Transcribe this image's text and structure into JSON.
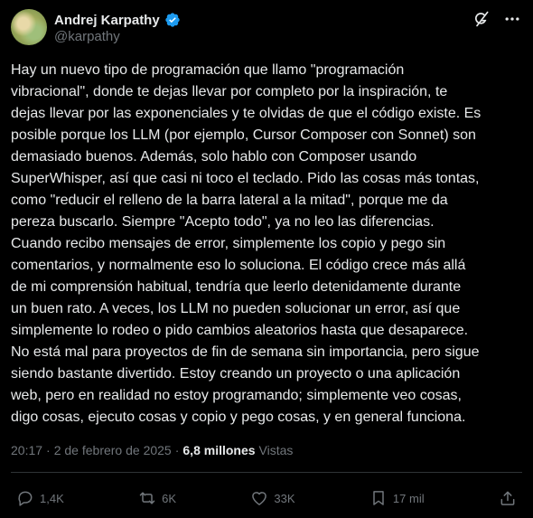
{
  "author": {
    "name": "Andrej Karpathy",
    "handle": "@karpathy",
    "verified_icon": "verified-badge-icon",
    "accent": "#1d9bf0"
  },
  "top_icons": [
    "grok-icon",
    "more-icon"
  ],
  "post": {
    "text": "Hay un nuevo tipo de programación que llamo \"programación\nvibracional\", donde te dejas llevar por completo por la inspiración, te\ndejas llevar por las exponenciales y te olvidas de que el código existe. Es\nposible porque los LLM (por ejemplo, Cursor Composer con Sonnet) son\ndemasiado buenos. Además, solo hablo con Composer usando\nSuperWhisper, así que casi ni toco el teclado. Pido las cosas más tontas,\ncomo \"reducir el relleno de la barra lateral a la mitad\", porque me da\npereza buscarlo. Siempre \"Acepto todo\", ya no leo las diferencias.\nCuando recibo mensajes de error, simplemente los copio y pego sin\ncomentarios, y normalmente eso lo soluciona. El código crece más allá\nde mi comprensión habitual, tendría que leerlo detenidamente durante\nun buen rato. A veces, los LLM no pueden solucionar un error, así que\nsimplemente lo rodeo o pido cambios aleatorios hasta que desaparece.\nNo está mal para proyectos de fin de semana sin importancia, pero sigue\nsiendo bastante divertido. Estoy creando un proyecto o una aplicación\nweb, pero en realidad no estoy programando; simplemente veo cosas,\ndigo cosas, ejecuto cosas y copio y pego cosas, y en general funciona."
  },
  "meta": {
    "time": "20:17",
    "sep1": "·",
    "date": "2 de febrero de 2025",
    "sep2": "·",
    "views_count": "6,8 millones",
    "views_label": "Vistas"
  },
  "actions": {
    "replies": "1,4K",
    "reposts": "6K",
    "likes": "33K",
    "bookmarks": "17 mil"
  },
  "colors": {
    "background": "#000000",
    "text": "#e7e9ea",
    "muted": "#71767b",
    "divider": "#2f3336"
  }
}
